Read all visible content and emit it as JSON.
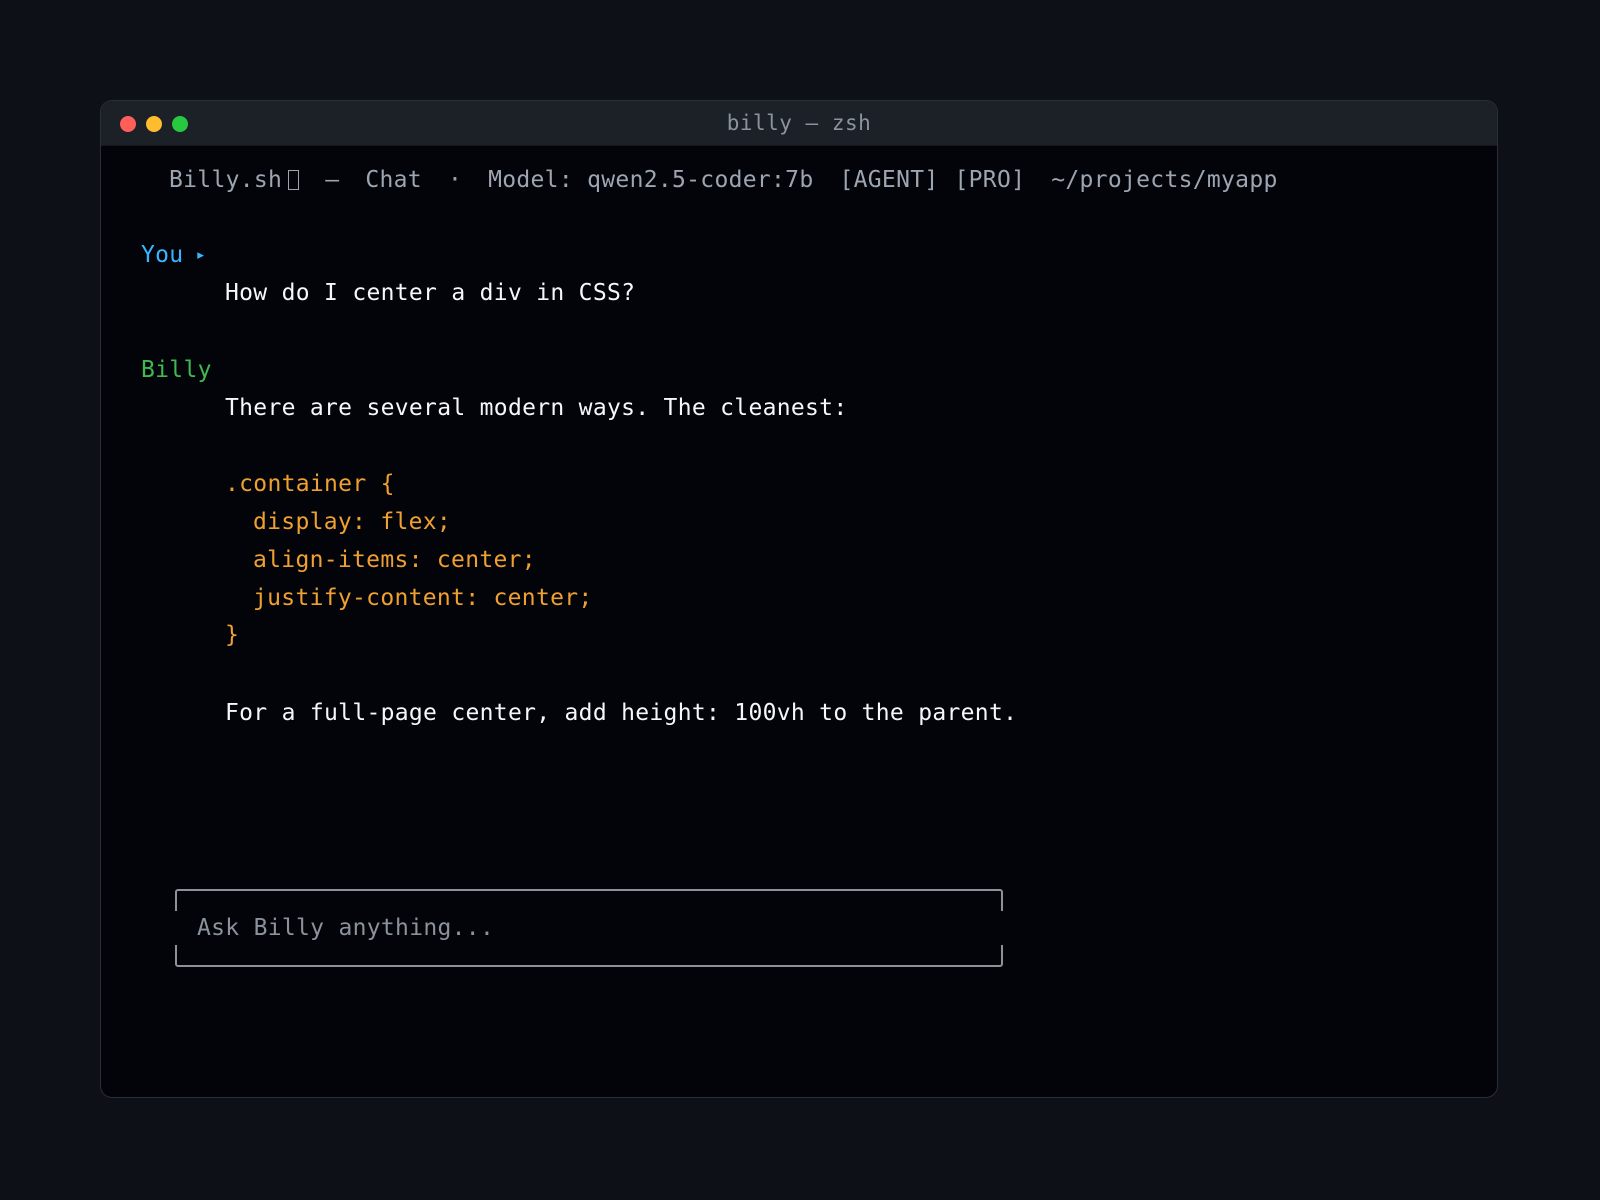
{
  "window": {
    "title": "billy — zsh"
  },
  "status_bar": {
    "app_name": "Billy.sh",
    "separator_dash": "—",
    "mode": "Chat",
    "separator_dot": "·",
    "model": "Model: qwen2.5-coder:7b",
    "tag_agent": "[AGENT]",
    "tag_pro": "[PRO]",
    "cwd": "~/projects/myapp"
  },
  "conversation": {
    "user": {
      "label": "You",
      "arrow": "▸",
      "message": "How do I center a div in CSS?"
    },
    "assistant": {
      "label": "Billy",
      "intro": "There are several modern ways. The cleanest:",
      "code_lines": [
        ".container {",
        "display: flex;",
        "align-items: center;",
        "justify-content: center;",
        "}"
      ],
      "outro": "For a full-page center, add height: 100vh to the parent."
    }
  },
  "input": {
    "value": "",
    "placeholder": "Ask Billy anything..."
  },
  "colors": {
    "user_accent": "#39b5ff",
    "assistant_accent": "#3fb950",
    "code": "#f0a030",
    "background": "#02040a"
  }
}
